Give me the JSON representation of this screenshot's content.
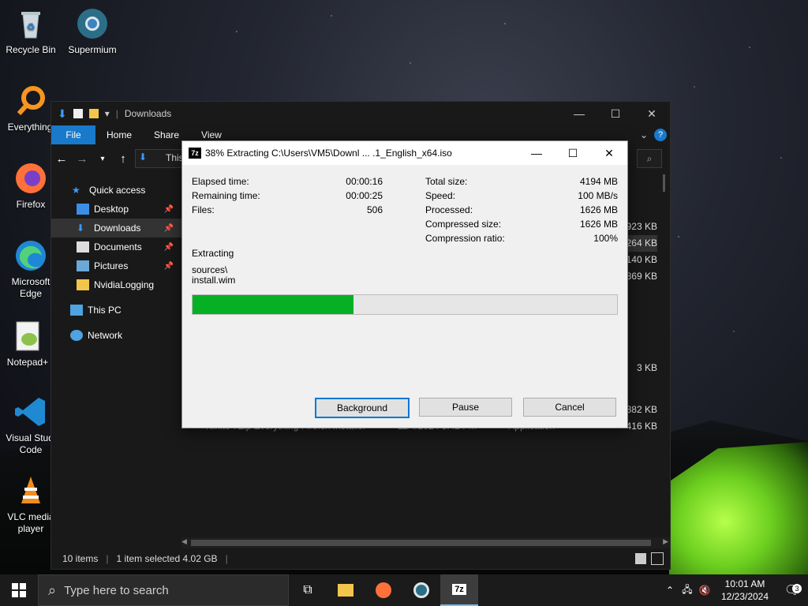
{
  "desktop": {
    "icons": [
      {
        "label": "Recycle Bin"
      },
      {
        "label": "Supermium"
      },
      {
        "label": "Everything"
      },
      {
        "label": "Firefox"
      },
      {
        "label": "Microsoft\nEdge"
      },
      {
        "label": "Notepad+"
      },
      {
        "label": "Visual Studi\nCode"
      },
      {
        "label": "VLC media\nplayer"
      }
    ]
  },
  "explorer": {
    "title": "Downloads",
    "ribbon": {
      "file": "File",
      "tabs": [
        "Home",
        "Share",
        "View"
      ]
    },
    "address": "This",
    "nav": {
      "quick_access": "Quick access",
      "items": [
        "Desktop",
        "Downloads",
        "Documents",
        "Pictures",
        "NvidiaLogging"
      ],
      "this_pc": "This PC",
      "network": "Network"
    },
    "sizes": [
      ",923 KB",
      ",264 KB",
      ",140 KB",
      ",869 KB",
      "3 KB",
      ",882 KB",
      "416 KB"
    ],
    "hidden_row": "Ninite 7Zip Everything Firefox Installer",
    "hidden_date": "11/4/2024 3:42 PM",
    "hidden_type": "Application",
    "status": {
      "items": "10 items",
      "selected": "1 item selected  4.02 GB"
    }
  },
  "dialog": {
    "title": "38% Extracting C:\\Users\\VM5\\Downl ... .1_English_x64.iso",
    "logo": "7z",
    "left_stats": [
      {
        "label": "Elapsed time:",
        "value": "00:00:16"
      },
      {
        "label": "Remaining time:",
        "value": "00:00:25"
      },
      {
        "label": "Files:",
        "value": "506"
      }
    ],
    "right_stats": [
      {
        "label": "Total size:",
        "value": "4194 MB"
      },
      {
        "label": "Speed:",
        "value": "100 MB/s"
      },
      {
        "label": "Processed:",
        "value": "1626 MB"
      },
      {
        "label": "Compressed size:",
        "value": "1626 MB"
      },
      {
        "label": "Compression ratio:",
        "value": "100%"
      }
    ],
    "action": "Extracting",
    "path_line1": "sources\\",
    "path_line2": "install.wim",
    "progress": 0.38,
    "buttons": {
      "background": "Background",
      "pause": "Pause",
      "cancel": "Cancel"
    }
  },
  "taskbar": {
    "search_placeholder": "Type here to search",
    "time": "10:01 AM",
    "date": "12/23/2024",
    "notifications": "3",
    "active_app_label": "7z"
  }
}
